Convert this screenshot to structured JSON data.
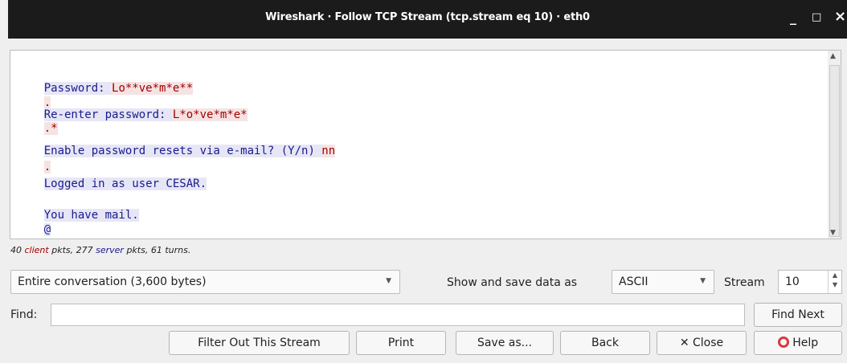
{
  "window": {
    "title": "Wireshark · Follow TCP Stream (tcp.stream eq 10) · eth0",
    "controls": {
      "minimize": "_",
      "maximize": "□",
      "close": "×"
    }
  },
  "stream_lines": [
    {
      "text": "Password: ",
      "role": "server"
    },
    {
      "text": "Lo**ve*m*e**",
      "role": "client"
    },
    {
      "text": ".",
      "role": "client"
    },
    {
      "text": "Re-enter password: ",
      "role": "server"
    },
    {
      "text": "L*o*ve*m*e*",
      "role": "client"
    },
    {
      "text": ".*",
      "role": "client"
    },
    {
      "text": "Enable password resets via e-mail? (Y/n) ",
      "role": "server"
    },
    {
      "text": "nn",
      "role": "client"
    },
    {
      "text": ".",
      "role": "client"
    },
    {
      "text": "Logged in as user CESAR.",
      "role": "server"
    },
    {
      "text": "You have mail.",
      "role": "server"
    },
    {
      "text": "@",
      "role": "server"
    },
    {
      "text": ".",
      "role": "client"
    }
  ],
  "stats": {
    "count_client": "40",
    "client_word": "client",
    "mid": "pkts, 277",
    "server_word": "server",
    "tail": "pkts, 61 turns."
  },
  "conversation_select": {
    "value": "Entire conversation (3,600 bytes)"
  },
  "show_save_label": "Show and save data as",
  "format_select": {
    "value": "ASCII"
  },
  "stream_label": "Stream",
  "stream_value": "10",
  "find": {
    "label": "Find:",
    "value": "",
    "button": "Find Next"
  },
  "buttons": {
    "filter_out": "Filter Out This Stream",
    "print": "Print",
    "save_as": "Save as...",
    "back": "Back",
    "close": "Close",
    "help": "Help"
  },
  "colors": {
    "client_text": "#a10000",
    "server_text": "#1a1a8c",
    "client_bg": "#f5e3e3",
    "server_bg": "#e6e6f6"
  }
}
